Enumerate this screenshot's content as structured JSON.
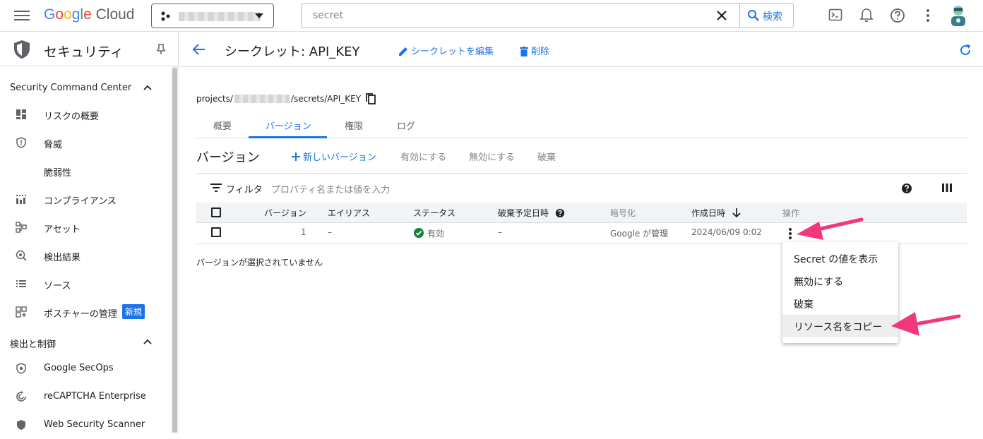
{
  "topbar": {
    "logo_g": "G",
    "logo_o1": "o",
    "logo_o2": "o",
    "logo_g2": "g",
    "logo_l": "l",
    "logo_e": "e",
    "logo_cloud": "Cloud",
    "search_value": "secret",
    "search_button": "検索",
    "icons": [
      "menu-icon",
      "project-icon",
      "close-icon",
      "search-icon",
      "terminal-icon",
      "bell-icon",
      "help-icon",
      "more-vert-icon",
      "avatar"
    ]
  },
  "sidebar": {
    "title": "セキュリティ",
    "section1": "Security Command Center",
    "items1": [
      {
        "label": "リスクの概要",
        "icon": "dashboard-icon"
      },
      {
        "label": "脅威",
        "icon": "shield-alert-icon"
      },
      {
        "label": "脆弱性",
        "icon": ""
      },
      {
        "label": "コンプライアンス",
        "icon": "compliance-icon"
      },
      {
        "label": "アセット",
        "icon": "asset-icon"
      },
      {
        "label": "検出結果",
        "icon": "findings-icon"
      },
      {
        "label": "ソース",
        "icon": "list-icon"
      },
      {
        "label": "ポスチャーの管理",
        "icon": "posture-icon",
        "badge": "新規"
      }
    ],
    "section2": "検出と制御",
    "items2": [
      {
        "label": "Google SecOps",
        "icon": "secops-icon"
      },
      {
        "label": "reCAPTCHA Enterprise",
        "icon": "recaptcha-icon"
      },
      {
        "label": "Web Security Scanner",
        "icon": "scanner-icon"
      }
    ]
  },
  "main": {
    "title": "シークレット: API_KEY",
    "edit_button": "シークレットを編集",
    "delete_button": "削除",
    "path_prefix": "projects/",
    "path_suffix": "/secrets/API_KEY",
    "tabs": [
      "概要",
      "バージョン",
      "権限",
      "ログ"
    ],
    "active_tab": "バージョン",
    "versions_title": "バージョン",
    "new_version": "新しいバージョン",
    "enable": "有効にする",
    "disable": "無効にする",
    "destroy": "破棄",
    "filter_label": "フィルタ",
    "filter_placeholder": "プロパティ名または値を入力",
    "columns": [
      "バージョン",
      "エイリアス",
      "ステータス",
      "破棄予定日時",
      "暗号化",
      "作成日時",
      "操作"
    ],
    "row": {
      "version": "1",
      "alias": "–",
      "status": "有効",
      "destroy_date": "–",
      "encryption": "Google が管理",
      "created": "2024/06/09 0:02"
    },
    "no_selection": "バージョンが選択されていません",
    "menu": [
      "Secret の値を表示",
      "無効にする",
      "破棄",
      "リソース名をコピー"
    ]
  },
  "colors": {
    "accent": "#1a73e8",
    "annotation_arrow": "#f0387a",
    "status_ok": "#188038"
  }
}
